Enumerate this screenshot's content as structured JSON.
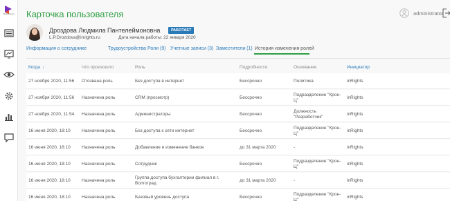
{
  "sidebar": {
    "logo_text": "Rostelecom",
    "items": [
      {
        "icon": "list-icon"
      },
      {
        "icon": "monitor-icon"
      },
      {
        "icon": "eye-icon"
      },
      {
        "icon": "gear-icon"
      },
      {
        "icon": "bar-chart-icon"
      },
      {
        "icon": "chat-icon"
      }
    ]
  },
  "header": {
    "title": "Карточка пользователя",
    "username": "administrator"
  },
  "user": {
    "full_name": "Дроздова Людмила Пантелеймоновна",
    "status": "РАБОТАЕТ",
    "email": "L.P.Drozdova@inrights.ru",
    "start_date": "Дата начала работы: 22 января 2020"
  },
  "tabs": [
    {
      "label": "Информация о сотруднике"
    },
    {
      "label": "Трудоустройства"
    },
    {
      "label": "Роли (9)"
    },
    {
      "label": "Учетные записи (3)"
    },
    {
      "label": "Заместители (1)"
    },
    {
      "label": "История изменения ролей",
      "active": true
    }
  ],
  "table": {
    "columns": [
      "Когда",
      "Что произошло",
      "Роль",
      "Подробности",
      "Основание",
      "Инициатор"
    ],
    "sort_indicator": "↓",
    "rows": [
      [
        "27 ноября 2020, 11:56",
        "Отозвана роль",
        "Без доступа в интернет",
        "Бессрочно",
        "Политика",
        "inRights"
      ],
      [
        "27 ноября 2020, 11:56",
        "Назначена роль",
        "CRM (просмотр)",
        "Бессрочно",
        "Подразделение \"Крон-Ц\"",
        "inRights"
      ],
      [
        "27 ноября 2020, 11:54",
        "Назначена роль",
        "Администраторы",
        "Бессрочно",
        "Должность \"Разработчик\"",
        "inRights"
      ],
      [
        "16 июня 2020, 18:10",
        "Назначена роль",
        "Без доступа к сети интернет",
        "Бессрочно",
        "Подразделение \"Крон-Ц\"",
        "inRights"
      ],
      [
        "16 июня 2020, 18:10",
        "Назначена роль",
        "Добавление и изменение банков",
        "до 31 марта 2020",
        "-",
        "inRights"
      ],
      [
        "16 июня 2020, 18:10",
        "Назначена роль",
        "Сотрудник",
        "Бессрочно",
        "Подразделение \"Крон-Ц\"",
        "inRights"
      ],
      [
        "16 июня 2020, 18:10",
        "Назначена роль",
        "Группа доступа бухгалтерии филиал в г. Волгоград",
        "до 31 марта 2020",
        "-",
        "inRights"
      ],
      [
        "16 июня 2020, 18:10",
        "Назначена роль",
        "Базовый уровень доступа",
        "Бессрочно",
        "Подразделение \"Крон-Ц\"",
        "inRights"
      ]
    ]
  },
  "colors": {
    "accent_green": "#2e9e44",
    "link_blue": "#2a7ab8",
    "badge_blue": "#2a7ab8",
    "logo_purple": "#7b2fbf"
  }
}
